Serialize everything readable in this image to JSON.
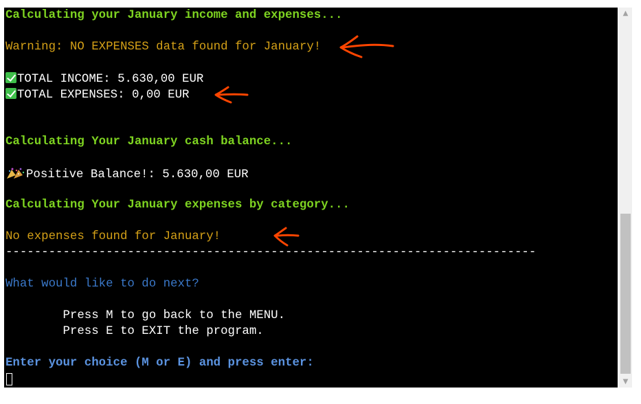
{
  "terminal": {
    "lines": {
      "calc_income": "Calculating your January income and expenses...",
      "warning": "Warning: NO EXPENSES data found for January!",
      "total_income": "TOTAL INCOME: 5.630,00 EUR",
      "total_expenses": "TOTAL EXPENSES: 0,00 EUR",
      "calc_balance": "Calculating Your January cash balance...",
      "positive_balance": "Positive Balance!: 5.630,00 EUR",
      "calc_category": "Calculating Your January expenses by category...",
      "no_expenses": "No expenses found for January!",
      "separator": "--------------------------------------------------------------------------",
      "next_prompt": "What would like to do next?",
      "option_menu": "        Press M to go back to the MENU.",
      "option_exit": "        Press E to EXIT the program.",
      "enter_choice": "Enter your choice (M or E) and press enter:"
    },
    "icons": {
      "check": "check-mark-icon",
      "party": "party-popper-icon"
    },
    "colors": {
      "background": "#000000",
      "heading_green": "#7ed321",
      "warning_orange": "#d4a017",
      "prompt_blue": "#3a78c9",
      "annotation_arrow": "#ff4500"
    }
  }
}
